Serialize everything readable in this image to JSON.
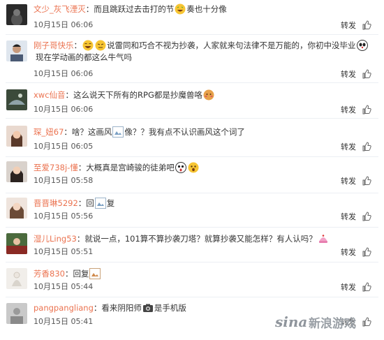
{
  "repost_label": "转发",
  "comments": [
    {
      "user": "文少_灰飞湮灭",
      "text_a": "：而且跳跃过去击打的节",
      "text_b": "奏也十分像",
      "line2": "",
      "time": "10月15日 06:06"
    },
    {
      "user": "刚子哥快乐",
      "text_a": "：",
      "text_b": "说雷同和巧合不视为抄袭，人家就来句法律不是万能的，你初中没毕业",
      "line2": "现在学动画的都这么牛气吗",
      "time": "10月15日 06:06"
    },
    {
      "user": "xwc仙音",
      "text_a": "：这么说天下所有的RPG都是抄魔兽咯",
      "text_b": "",
      "line2": "",
      "time": "10月15日 06:06"
    },
    {
      "user": "琛_妞67",
      "text_a": "：啥？这画风",
      "text_b": "像？？我有点不认识画风这个词了",
      "line2": "",
      "time": "10月15日 06:05"
    },
    {
      "user": "至爱738j-懂",
      "text_a": "：大概真是宫崎骏的徒弟吧",
      "text_b": "",
      "line2": "",
      "time": "10月15日 05:58"
    },
    {
      "user": "晋晋琳5292",
      "text_a": "：回",
      "text_b": "复",
      "line2": "",
      "time": "10月15日 05:56"
    },
    {
      "user": "湿儿Ling53",
      "text_a": "：就说一点，101算不算抄袭刀塔？就算抄袭又能怎样？有人认吗？",
      "text_b": "",
      "line2": "",
      "time": "10月15日 05:51"
    },
    {
      "user": "芳香830",
      "text_a": "：回复",
      "text_b": "",
      "line2": "",
      "time": "10月15日 05:44"
    },
    {
      "user": "pangpangliang",
      "text_a": "：看来阴阳师",
      "text_b": "是手机版",
      "line2": "",
      "time": "10月15日 05:41"
    }
  ],
  "watermark": {
    "brand": "sina",
    "site": "新浪游戏"
  },
  "colors": {
    "username": "#eb7350",
    "text": "#333333",
    "divider": "#eceff3"
  }
}
